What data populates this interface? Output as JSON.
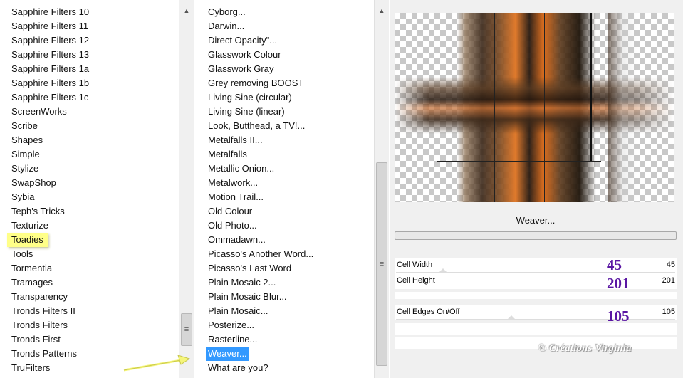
{
  "categories": {
    "items": [
      {
        "label": "Sapphire Filters 10"
      },
      {
        "label": "Sapphire Filters 11"
      },
      {
        "label": "Sapphire Filters 12"
      },
      {
        "label": "Sapphire Filters 13"
      },
      {
        "label": "Sapphire Filters 1a"
      },
      {
        "label": "Sapphire Filters 1b"
      },
      {
        "label": "Sapphire Filters 1c"
      },
      {
        "label": "ScreenWorks"
      },
      {
        "label": "Scribe"
      },
      {
        "label": "Shapes"
      },
      {
        "label": "Simple"
      },
      {
        "label": "Stylize"
      },
      {
        "label": "SwapShop"
      },
      {
        "label": "Sybia"
      },
      {
        "label": "Teph's Tricks"
      },
      {
        "label": "Texturize"
      },
      {
        "label": "Toadies"
      },
      {
        "label": "Tools"
      },
      {
        "label": "Tormentia"
      },
      {
        "label": "Tramages"
      },
      {
        "label": "Transparency"
      },
      {
        "label": "Tronds Filters II"
      },
      {
        "label": "Tronds Filters"
      },
      {
        "label": "Tronds First"
      },
      {
        "label": "Tronds Patterns"
      },
      {
        "label": "TruFilters"
      }
    ],
    "selected": "Toadies"
  },
  "filters": {
    "items": [
      {
        "label": "Cyborg..."
      },
      {
        "label": "Darwin..."
      },
      {
        "label": "Direct Opacity\"..."
      },
      {
        "label": "Glasswork Colour"
      },
      {
        "label": "Glasswork Gray"
      },
      {
        "label": "Grey removing BOOST"
      },
      {
        "label": "Living Sine (circular)"
      },
      {
        "label": "Living Sine (linear)"
      },
      {
        "label": "Look, Butthead, a TV!..."
      },
      {
        "label": "Metalfalls II..."
      },
      {
        "label": "Metalfalls"
      },
      {
        "label": "Metallic Onion..."
      },
      {
        "label": "Metalwork..."
      },
      {
        "label": "Motion Trail..."
      },
      {
        "label": "Old Colour"
      },
      {
        "label": "Old Photo..."
      },
      {
        "label": "Ommadawn..."
      },
      {
        "label": "Picasso's Another Word..."
      },
      {
        "label": "Picasso's Last Word"
      },
      {
        "label": "Plain Mosaic 2..."
      },
      {
        "label": "Plain Mosaic Blur..."
      },
      {
        "label": "Plain Mosaic..."
      },
      {
        "label": "Posterize..."
      },
      {
        "label": "Rasterline..."
      },
      {
        "label": "Weaver..."
      },
      {
        "label": "What are you?"
      }
    ],
    "selected": "Weaver..."
  },
  "scrollbars": {
    "up_arrow": "▲",
    "grip": "≡"
  },
  "preview": {
    "filter_title": "Weaver...",
    "params": [
      {
        "label": "Cell Width",
        "value": "45",
        "annotation": "45"
      },
      {
        "label": "Cell Height",
        "value": "201",
        "annotation": "201"
      },
      {
        "label": "Cell Edges On/Off",
        "value": "105",
        "annotation": "105"
      }
    ],
    "watermark": "© Créations Virginia"
  },
  "colors": {
    "highlight": "#ffff88",
    "selection": "#3399ff",
    "annotation": "#5a16a3",
    "preview_orange": "#e07a2c"
  }
}
